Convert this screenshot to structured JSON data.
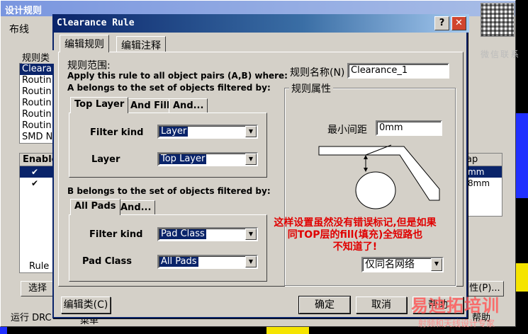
{
  "colors": {
    "dialog_title": "#0a246a",
    "selection": "#0a246a",
    "note": "#e00000",
    "pcb_background": "#000000",
    "pcb_yellow": "#f5e400",
    "pcb_blue": "#2030ff"
  },
  "parent": {
    "title": "设计规则",
    "tab": "布线",
    "rule_list_header": "规则类",
    "rule_list": [
      "Cleara",
      "Routin",
      "Routin",
      "Routin",
      "Routin",
      "Routin",
      "SMD N"
    ],
    "enable_header": "Enable",
    "rule_label": "Rule",
    "right_header": "ap",
    "right_rows": [
      "mm",
      "8mm"
    ],
    "bottom_left": "运行 DRC",
    "select_btn": "选择",
    "menu_fragment": "菜单",
    "prop_btn": "性(P)...",
    "help_btn": "帮助",
    "close_btn": "✕"
  },
  "watermark": {
    "scan_hint": "微信联系",
    "brand": "易迪拓培训",
    "slogan": "射频和天线设计专家"
  },
  "dialog": {
    "title": "Clearance Rule",
    "help_btn": "?",
    "close_btn": "✕",
    "tabs": [
      "编辑规则",
      "编辑注释"
    ],
    "scope_heading": "规则范围:",
    "apply_text": "Apply this rule to all object pairs (A,B) where:",
    "a_text": "A belongs to the set of objects filtered by:",
    "a_tabs": [
      "Top Layer",
      "And Fill",
      "And..."
    ],
    "a_filter_label": "Filter kind",
    "a_filter_value": "Layer",
    "a_layer_label": "Layer",
    "a_layer_value": "Top Layer",
    "b_text": "B belongs to the set of objects filtered by:",
    "b_tabs": [
      "All Pads",
      "And..."
    ],
    "b_filter_label": "Filter kind",
    "b_filter_value": "Pad Class",
    "b_class_label": "Pad Class",
    "b_class_value": "All Pads",
    "rule_name_label": "规则名称(N)",
    "rule_name_value": "Clearance_1",
    "rule_props_label": "规则属性",
    "min_gap_label": "最小间距",
    "min_gap_value": "0mm",
    "net_scope_value": "仅同名网络",
    "note_lines": [
      "这样设置虽然没有错误标记,但是如果",
      "同TOP层的fill(填充)全短路也",
      "不知道了!"
    ],
    "edit_class_btn": "编辑类(C)",
    "ok_btn": "确定",
    "cancel_btn": "取消",
    "help_text_btn": "帮助"
  }
}
